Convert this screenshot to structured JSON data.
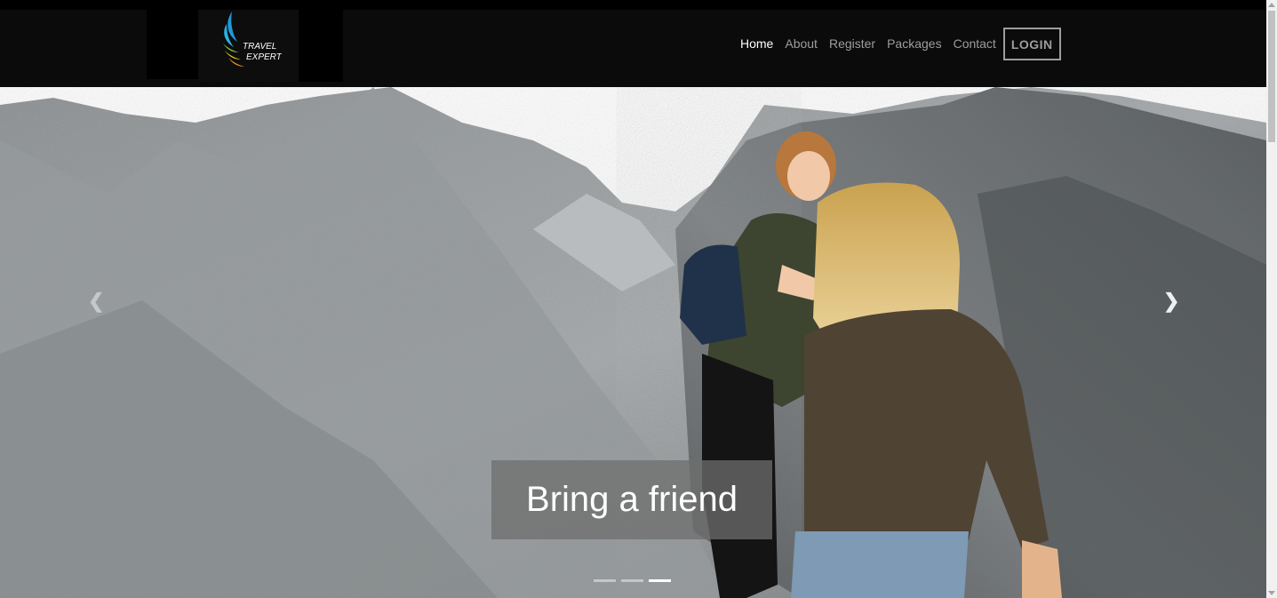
{
  "brand": {
    "logo_text_line1": "TRAVEL",
    "logo_text_line2": "EXPERTS",
    "accent_colors": [
      "#1e9ad6",
      "#2ab3e6",
      "#8cc63f",
      "#f6d21c",
      "#f39a1e"
    ]
  },
  "nav": {
    "items": [
      {
        "label": "Home",
        "active": true
      },
      {
        "label": "About",
        "active": false
      },
      {
        "label": "Register",
        "active": false
      },
      {
        "label": "Packages",
        "active": false
      },
      {
        "label": "Contact",
        "active": false
      }
    ],
    "login_label": "LOGIN"
  },
  "carousel": {
    "caption": "Bring a friend",
    "prev_icon": "chevron-left-icon",
    "next_icon": "chevron-right-icon",
    "prev_glyph": "❮",
    "next_glyph": "❯",
    "slide_count": 3,
    "active_slide": 3
  },
  "colors": {
    "navbar_bg": "#0b0b0b",
    "nav_text": "#9d9d9d",
    "nav_active": "#ffffff"
  }
}
